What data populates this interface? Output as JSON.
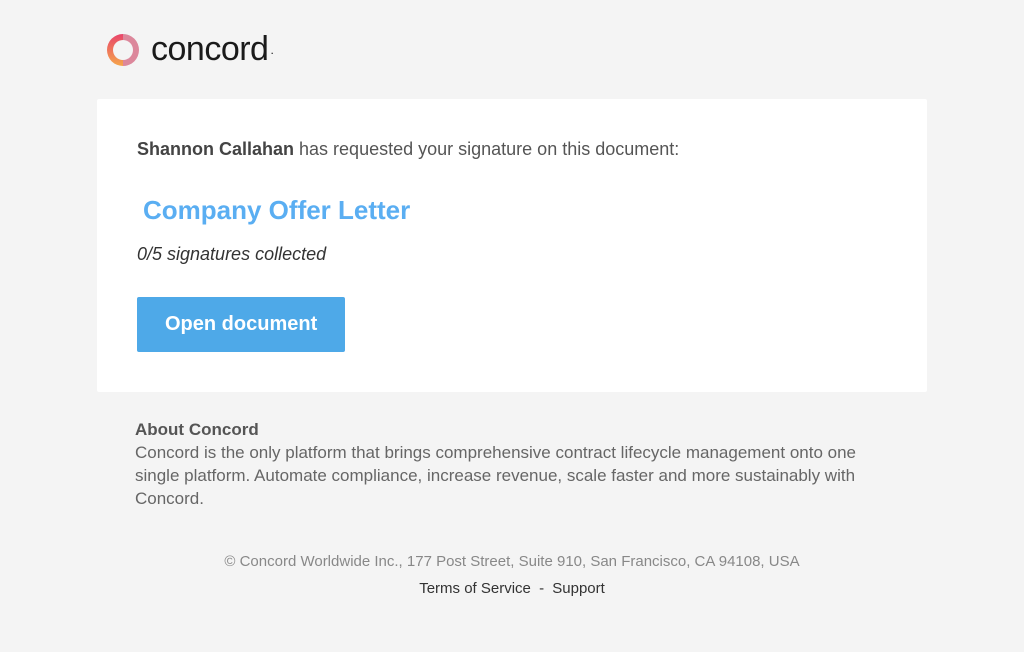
{
  "brand": {
    "name": "concord",
    "tm": "."
  },
  "request": {
    "requester": "Shannon Callahan",
    "suffix": " has requested your signature on this document:"
  },
  "document": {
    "title": "Company Offer Letter",
    "signatures_status": "0/5 signatures collected",
    "open_label": "Open document"
  },
  "about": {
    "heading": "About Concord",
    "body": "Concord is the only platform that brings comprehensive contract lifecycle management onto one single platform. Automate compliance, increase revenue, scale faster and more sustainably with Concord."
  },
  "footer": {
    "copyright": "© Concord Worldwide Inc., 177 Post Street, Suite 910, San Francisco, CA 94108, USA",
    "terms_label": "Terms of Service",
    "support_label": "Support",
    "separator": "-"
  }
}
